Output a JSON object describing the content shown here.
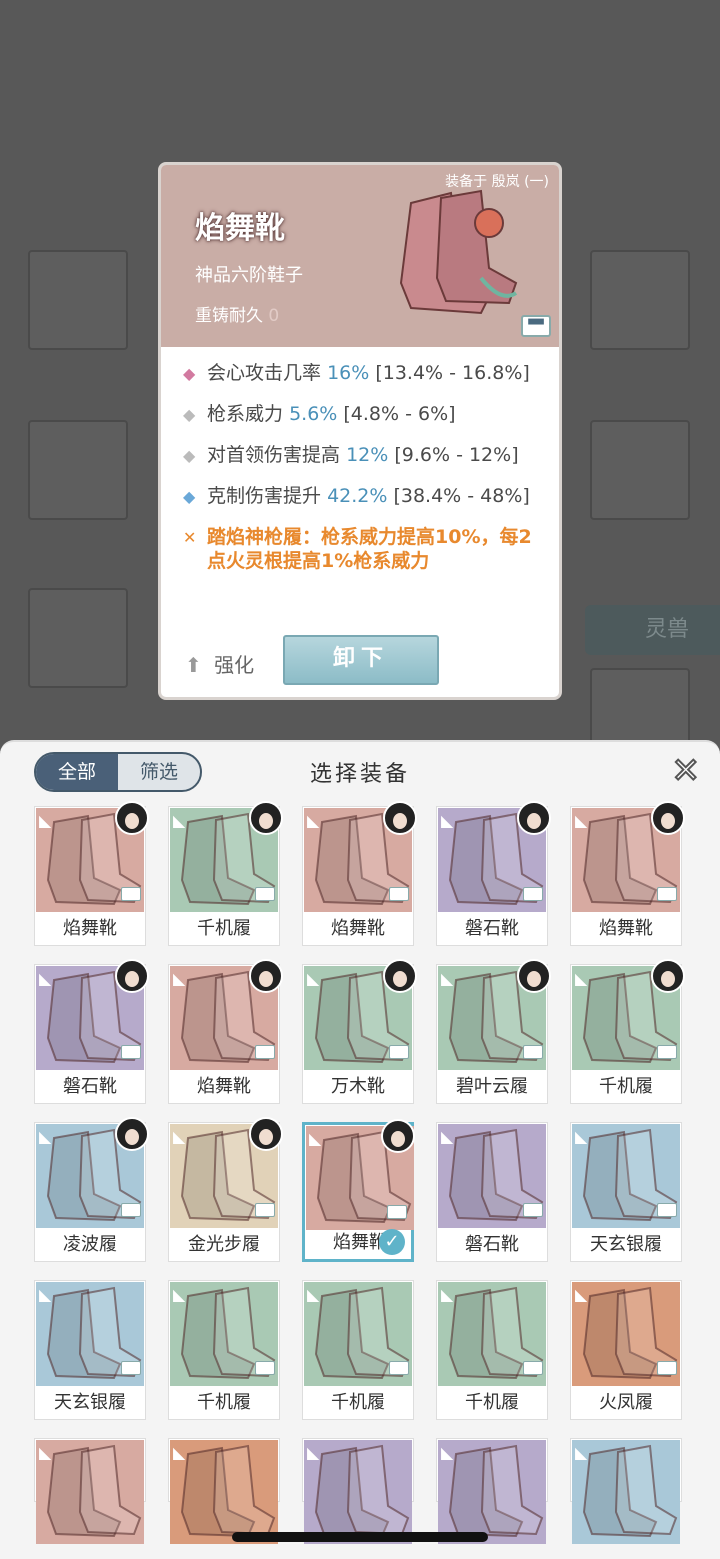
{
  "colors": {
    "rose_boot": "#d7aaa1",
    "jade_boot": "#a9c9b4",
    "violet_boot": "#b6aacb",
    "ice_boot": "#a9c8d8",
    "gold_boot": "#e1d2b8",
    "fire_boot": "#d99b7b",
    "accent": "#5fb3c9",
    "special_text": "#e8892e"
  },
  "background": {
    "tab_label": "灵兽"
  },
  "detail": {
    "equipped_on": "装备于 殷岚 (一)",
    "name": "焰舞靴",
    "grade": "神品六阶鞋子",
    "recast_label": "重铸耐久",
    "recast_value": "0",
    "stats": [
      {
        "name": "会心攻击几率",
        "value": "16%",
        "range": "[13.4% - 16.8%]",
        "bullet_color": "#d27aa0",
        "icon": "diamond-icon"
      },
      {
        "name": "枪系威力",
        "value": "5.6%",
        "range": "[4.8% - 6%]",
        "bullet_color": "#bbbbbb",
        "icon": "diamond-icon"
      },
      {
        "name": "对首领伤害提高",
        "value": "12%",
        "range": "[9.6% - 12%]",
        "bullet_color": "#bbbbbb",
        "icon": "diamond-icon"
      },
      {
        "name": "克制伤害提升",
        "value": "42.2%",
        "range": "[38.4% - 48%]",
        "bullet_color": "#6aa8d8",
        "icon": "diamond-icon"
      }
    ],
    "special": "踏焰神枪履：枪系威力提高10%，每2点火灵根提高1%枪系威力",
    "enhance_label": "强化",
    "unequip_label": "卸下"
  },
  "sheet": {
    "title": "选择装备",
    "tab_all": "全部",
    "tab_filter": "筛选",
    "items": [
      {
        "label": "焰舞靴",
        "color": "rose_boot",
        "portrait": true,
        "selected": false
      },
      {
        "label": "千机履",
        "color": "jade_boot",
        "portrait": true,
        "selected": false
      },
      {
        "label": "焰舞靴",
        "color": "rose_boot",
        "portrait": true,
        "selected": false
      },
      {
        "label": "磐石靴",
        "color": "violet_boot",
        "portrait": true,
        "selected": false
      },
      {
        "label": "焰舞靴",
        "color": "rose_boot",
        "portrait": true,
        "selected": false
      },
      {
        "label": "磐石靴",
        "color": "violet_boot",
        "portrait": true,
        "selected": false
      },
      {
        "label": "焰舞靴",
        "color": "rose_boot",
        "portrait": true,
        "selected": false
      },
      {
        "label": "万木靴",
        "color": "jade_boot",
        "portrait": true,
        "selected": false
      },
      {
        "label": "碧叶云履",
        "color": "jade_boot",
        "portrait": true,
        "selected": false
      },
      {
        "label": "千机履",
        "color": "jade_boot",
        "portrait": true,
        "selected": false
      },
      {
        "label": "凌波履",
        "color": "ice_boot",
        "portrait": true,
        "selected": false
      },
      {
        "label": "金光步履",
        "color": "gold_boot",
        "portrait": true,
        "selected": false
      },
      {
        "label": "焰舞靴",
        "color": "rose_boot",
        "portrait": true,
        "selected": true
      },
      {
        "label": "磐石靴",
        "color": "violet_boot",
        "portrait": false,
        "selected": false
      },
      {
        "label": "天玄银履",
        "color": "ice_boot",
        "portrait": false,
        "selected": false
      },
      {
        "label": "天玄银履",
        "color": "ice_boot",
        "portrait": false,
        "selected": false
      },
      {
        "label": "千机履",
        "color": "jade_boot",
        "portrait": false,
        "selected": false
      },
      {
        "label": "千机履",
        "color": "jade_boot",
        "portrait": false,
        "selected": false
      },
      {
        "label": "千机履",
        "color": "jade_boot",
        "portrait": false,
        "selected": false
      },
      {
        "label": "火凤履",
        "color": "fire_boot",
        "portrait": false,
        "selected": false
      },
      {
        "label": "",
        "color": "rose_boot",
        "portrait": false,
        "selected": false
      },
      {
        "label": "",
        "color": "fire_boot",
        "portrait": false,
        "selected": false
      },
      {
        "label": "",
        "color": "violet_boot",
        "portrait": false,
        "selected": false
      },
      {
        "label": "",
        "color": "violet_boot",
        "portrait": false,
        "selected": false
      },
      {
        "label": "",
        "color": "ice_boot",
        "portrait": false,
        "selected": false
      }
    ]
  }
}
